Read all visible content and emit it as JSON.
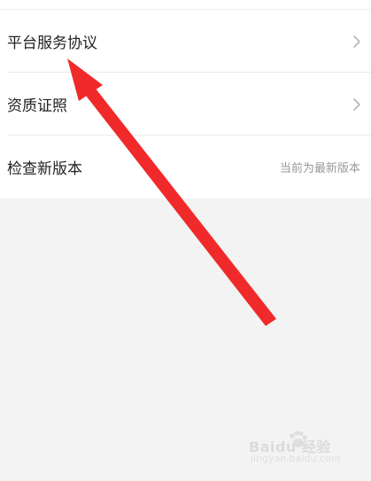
{
  "settings": {
    "items": [
      {
        "label": "平台服务协议",
        "value": "",
        "chevron_icon": "chevron-right-icon"
      },
      {
        "label": "资质证照",
        "value": "",
        "chevron_icon": "chevron-right-icon"
      },
      {
        "label": "检查新版本",
        "value": "当前为最新版本"
      }
    ]
  },
  "annotation": {
    "type": "arrow",
    "color": "#f02a2a",
    "points_to": "平台服务协议"
  },
  "watermark": {
    "brand": "Baidu",
    "product": "经验",
    "domain": "jingyan.baidu.com",
    "icon": "paw-icon"
  }
}
